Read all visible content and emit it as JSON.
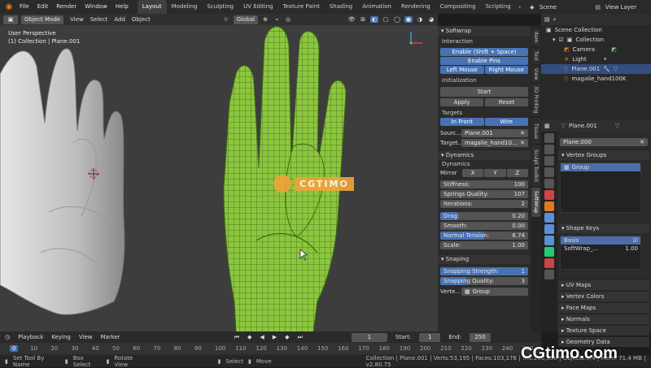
{
  "menu": [
    "File",
    "Edit",
    "Render",
    "Window",
    "Help"
  ],
  "workspaces": [
    "Layout",
    "Modeling",
    "Sculpting",
    "UV Editing",
    "Texture Paint",
    "Shading",
    "Animation",
    "Rendering",
    "Compositing",
    "Scripting"
  ],
  "scene": "Scene",
  "view_layer": "View Layer",
  "viewport_header": {
    "mode": "Object Mode",
    "view": "View",
    "select": "Select",
    "add": "Add",
    "object": "Object",
    "orientation": "Global"
  },
  "viewport": {
    "perspective": "User Perspective",
    "collection_line": "(1) Collection | Plane.001",
    "watermark": "CGTIMO"
  },
  "npanel": {
    "title": "Softwrap",
    "interaction_label": "Interaction",
    "enable_btn": "Enable (Shift + Space)",
    "enable_pins": "Enable Pins",
    "left_mouse": "Left Mouse",
    "right_mouse": "Right Mouse",
    "init_label": "Initialization",
    "start": "Start",
    "apply": "Apply",
    "reset": "Reset",
    "targets_label": "Targets",
    "in_front": "In Front",
    "wire": "Wire",
    "source_label": "Sourc...",
    "source_val": "Plane.001",
    "target_label": "Target...",
    "target_val": "magalie_hand10...",
    "dynamics_title": "Dynamics",
    "dynamics_label": "Dynamics",
    "mirror": "Mirror",
    "x": "X",
    "y": "Y",
    "z": "Z",
    "stiffness_l": "Stiffness:",
    "stiffness_v": "100",
    "springs_l": "Springs Quality:",
    "springs_v": "107",
    "iterations_l": "Iterations:",
    "iterations_v": "2",
    "drag_l": "Drag:",
    "drag_v": "0.20",
    "smooth_l": "Smooth:",
    "smooth_v": "0.00",
    "tension_l": "Normal Tension:",
    "tension_v": "6.74",
    "scale_l": "Scale:",
    "scale_v": "1.00",
    "snaping_title": "Snaping",
    "snap_strength_l": "Snapping Strength:",
    "snap_strength_v": "1",
    "snap_quality_l": "Snapping Quality:",
    "snap_quality_v": "3",
    "verte_l": "Verte...",
    "verte_v": "Group"
  },
  "vtabs": [
    "Item",
    "Tool",
    "View",
    "3D Printing",
    "Tissue",
    "Sculpt Toolkit",
    "SoftWrap"
  ],
  "outliner": {
    "scene_collection": "Scene Collection",
    "items": [
      "Collection",
      "Camera",
      "Light",
      "Plane.001",
      "magalie_hand100K"
    ]
  },
  "props": {
    "object_name": "Plane.001",
    "mesh_name": "Plane.000",
    "vertex_groups": "Vertex Groups",
    "group": "Group",
    "shape_keys": "Shape Keys",
    "basis": "Basis",
    "softwrap_key": "SoftWrap_...",
    "softwrap_val": "1.00",
    "sections": [
      "UV Maps",
      "Vertex Colors",
      "Face Maps",
      "Normals",
      "Texture Space",
      "Geometry Data"
    ]
  },
  "timeline": {
    "playback": "Playback",
    "keying": "Keying",
    "view": "View",
    "marker": "Marker",
    "frame": "1",
    "start_l": "Start:",
    "start_v": "1",
    "end_l": "End:",
    "end_v": "250",
    "ticks": [
      "0",
      "10",
      "20",
      "30",
      "40",
      "50",
      "60",
      "70",
      "80",
      "90",
      "100",
      "110",
      "120",
      "130",
      "140",
      "150",
      "160",
      "170",
      "180",
      "190",
      "200",
      "210",
      "220",
      "230",
      "240",
      "250"
    ]
  },
  "status": {
    "set_tool": "Set Tool By Name",
    "box_select": "Box Select",
    "rotate_view": "Rotate View",
    "select": "Select",
    "move": "Move",
    "stats": "Collection | Plane.001 | Verts:53,195 | Faces:103,176 | Tris:206,350 | Objects:0/4 | Mem: 71.4 MB | v2.80.75",
    "watermark": "CGtimo.com"
  },
  "colors": {
    "accent": "#4772b3",
    "mesh": "#8cc63f",
    "hand": "#cfcfcf",
    "orange": "#e07a22"
  }
}
